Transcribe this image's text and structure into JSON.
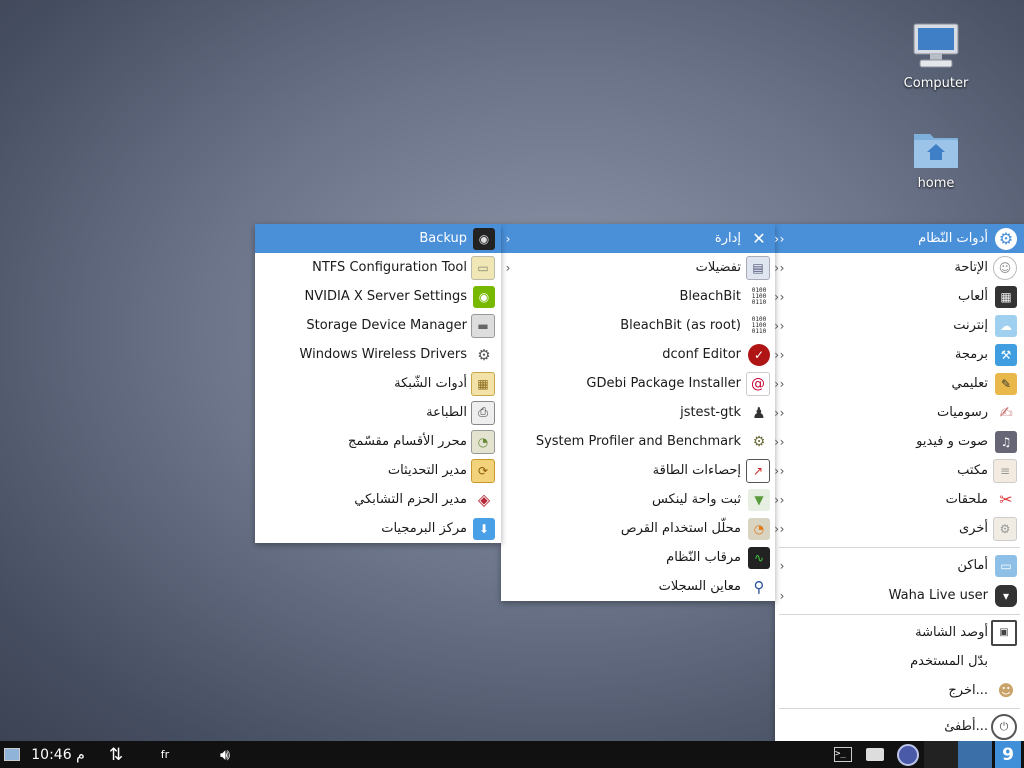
{
  "desktop": {
    "icons": [
      {
        "label": "Computer",
        "icon": "computer-icon"
      },
      {
        "label": "home",
        "icon": "home-folder-icon"
      }
    ]
  },
  "main_menu": {
    "items": [
      {
        "label": "أدوات النّظام",
        "icon": "gear-icon",
        "selected": true,
        "submenu": true
      },
      {
        "label": "الإتاحة",
        "icon": "accessibility-icon",
        "submenu": true
      },
      {
        "label": "ألعاب",
        "icon": "games-icon",
        "submenu": true
      },
      {
        "label": "إنترنت",
        "icon": "internet-icon",
        "submenu": true
      },
      {
        "label": "برمجة",
        "icon": "programming-icon",
        "submenu": true
      },
      {
        "label": "تعليمي",
        "icon": "education-icon",
        "submenu": true
      },
      {
        "label": "رسوميات",
        "icon": "graphics-icon",
        "submenu": true
      },
      {
        "label": "صوت و فيديو",
        "icon": "multimedia-icon",
        "submenu": true
      },
      {
        "label": "مكتب",
        "icon": "office-icon",
        "submenu": true
      },
      {
        "label": "ملحقات",
        "icon": "accessories-icon",
        "submenu": true
      },
      {
        "label": "أخرى",
        "icon": "other-icon",
        "submenu": true
      },
      {
        "label": "أماكن",
        "icon": "places-folder-icon",
        "submenu": true
      },
      {
        "label": "Waha Live user",
        "icon": "user-speech-icon",
        "submenu": true
      },
      {
        "label": "أوصد الشاشة",
        "icon": "lock-screen-icon",
        "submenu": false
      },
      {
        "label": "بدّل المستخدم",
        "icon": "",
        "submenu": false
      },
      {
        "label": "اخرج...",
        "icon": "logout-icon",
        "submenu": false
      },
      {
        "label": "أطفئ...",
        "icon": "power-icon",
        "submenu": false
      }
    ]
  },
  "admin_menu": {
    "items": [
      {
        "label": "إدارة",
        "icon": "tools-icon",
        "selected": true,
        "submenu": true
      },
      {
        "label": "تفضيلات",
        "icon": "preferences-icon",
        "submenu": true
      },
      {
        "label": "BleachBit",
        "icon": "bleachbit-icon"
      },
      {
        "label": "BleachBit (as root)",
        "icon": "bleachbit-root-icon"
      },
      {
        "label": "dconf Editor",
        "icon": "dconf-icon"
      },
      {
        "label": "GDebi Package Installer",
        "icon": "debian-package-icon"
      },
      {
        "label": "jstest-gtk",
        "icon": "joystick-icon"
      },
      {
        "label": "System Profiler and Benchmark",
        "icon": "profiler-icon"
      },
      {
        "label": "إحصاءات الطاقة",
        "icon": "power-stats-icon"
      },
      {
        "label": "ثبت واحة لينكس",
        "icon": "installer-icon"
      },
      {
        "label": "محلّل استخدام القرص",
        "icon": "disk-usage-icon"
      },
      {
        "label": "مرقاب النّظام",
        "icon": "system-monitor-icon"
      },
      {
        "label": "معاين السجلات",
        "icon": "log-viewer-icon"
      }
    ]
  },
  "system_menu": {
    "items": [
      {
        "label": "Backup",
        "icon": "backup-icon",
        "selected": true
      },
      {
        "label": "NTFS Configuration Tool",
        "icon": "ntfs-drive-icon"
      },
      {
        "label": "NVIDIA X Server Settings",
        "icon": "nvidia-icon"
      },
      {
        "label": "Storage Device Manager",
        "icon": "storage-drive-icon"
      },
      {
        "label": "Windows Wireless Drivers",
        "icon": "wireless-drivers-icon"
      },
      {
        "label": "أدوات الشّبكة",
        "icon": "network-tools-icon"
      },
      {
        "label": "الطباعة",
        "icon": "printer-icon"
      },
      {
        "label": "محرر الأقسام مقسّمج",
        "icon": "partition-editor-icon"
      },
      {
        "label": "مدير التحديثات",
        "icon": "update-manager-icon"
      },
      {
        "label": "مدير الحزم التشابكي",
        "icon": "package-manager-icon"
      },
      {
        "label": "مركز البرمجيات",
        "icon": "software-center-icon"
      }
    ]
  },
  "taskbar": {
    "clock": "10:46 م",
    "keyboard_layout": "fr",
    "items": [
      "terminal-icon",
      "file-manager-icon",
      "browser-icon",
      "workspace-switcher-icon",
      "app-menu-icon"
    ]
  },
  "colors": {
    "selection": "#4a90d9",
    "taskbar": "#111111"
  }
}
